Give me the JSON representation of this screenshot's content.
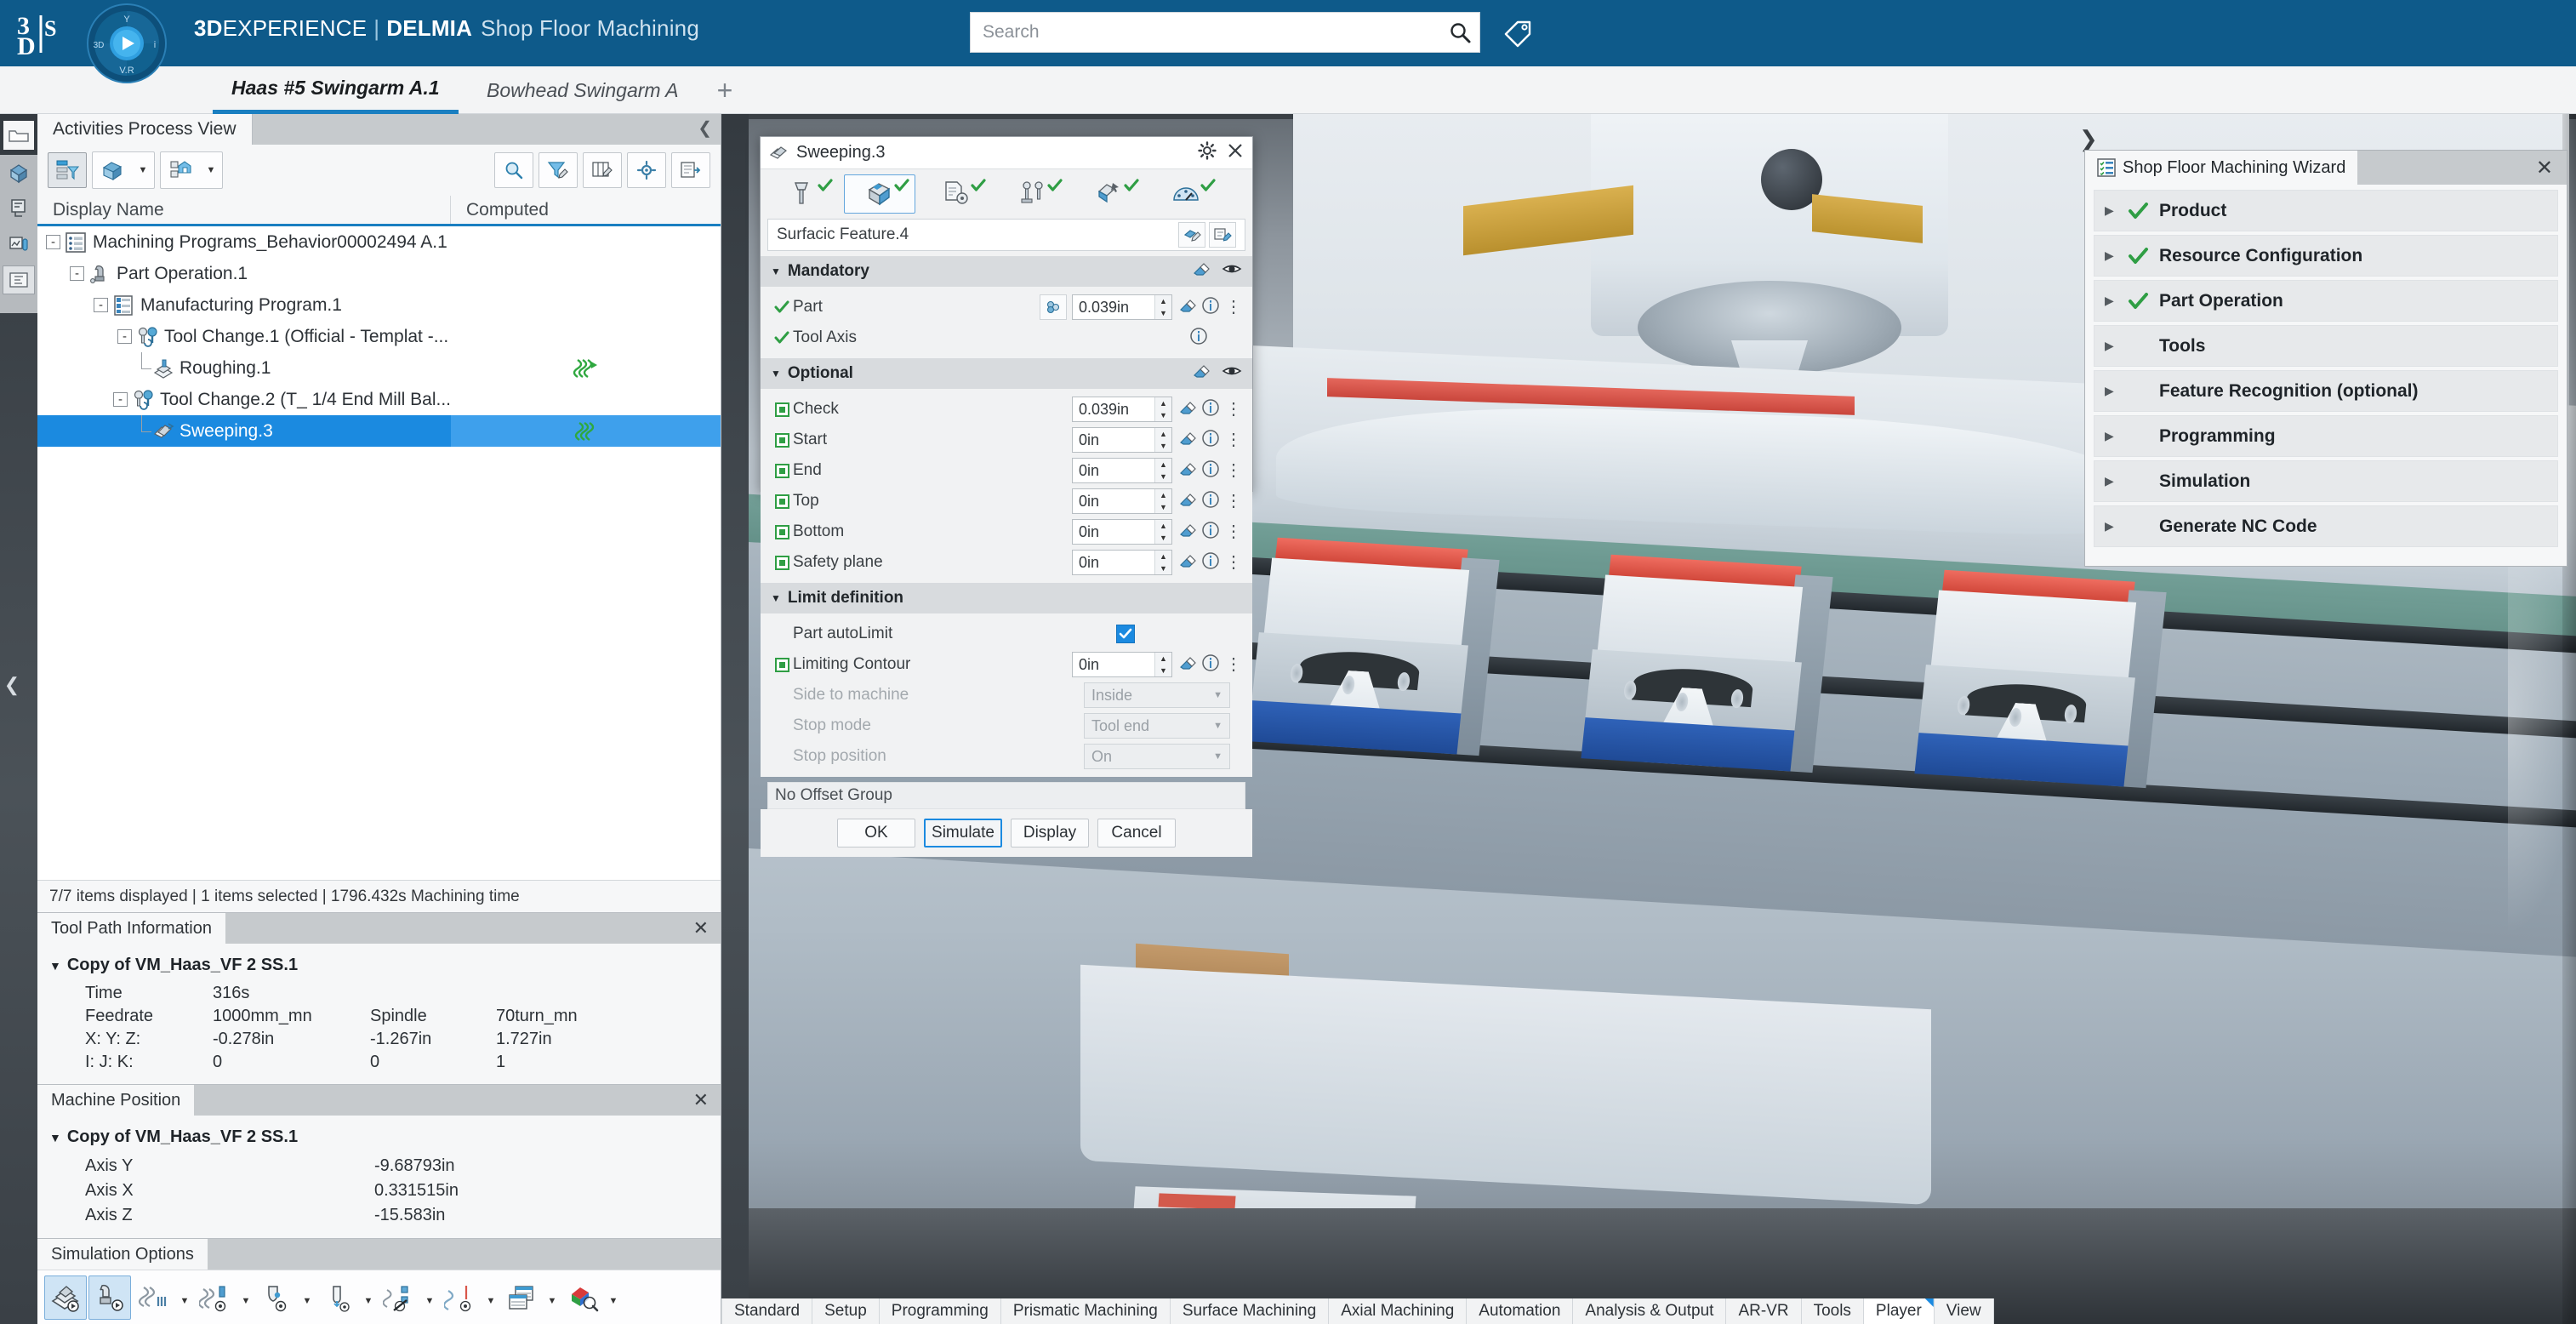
{
  "app": {
    "brand_bold": "3D",
    "brand_rest": "EXPERIENCE",
    "brand_sep": "|",
    "brand_suite": "DELMIA",
    "brand_app": "Shop Floor Machining",
    "logo_text": "3DS",
    "accent_blue": "#0e5a8a",
    "select_blue": "#1b8ae0",
    "check_green": "#2f9e44"
  },
  "search": {
    "placeholder": "Search",
    "value": "",
    "icon": "search-icon",
    "tag_icon": "tag-icon"
  },
  "tabs": {
    "items": [
      {
        "label": "Haas #5 Swingarm A.1",
        "active": true
      },
      {
        "label": "Bowhead Swingarm A",
        "active": false
      }
    ],
    "add_label": "+"
  },
  "left_rail": {
    "icons": [
      "folder-icon",
      "model-icon",
      "behavior-icon",
      "analysis-icon",
      "tree-icon"
    ]
  },
  "activities_panel": {
    "tab_label": "Activities Process View",
    "collapse_icon": "chevron-up-icon",
    "toolbar": [
      {
        "name": "filter-tree-button",
        "icon": "filter-tree-icon",
        "has_caret": false
      },
      {
        "name": "product-view-button",
        "icon": "product-cube-icon",
        "has_caret": true
      },
      {
        "name": "home-scope-button",
        "icon": "home-scope-icon",
        "has_caret": true
      },
      {
        "name": "search-button",
        "icon": "magnifier-icon",
        "has_caret": false
      },
      {
        "name": "edit-filter-button",
        "icon": "funnel-edit-icon",
        "has_caret": false
      },
      {
        "name": "edit-columns-button",
        "icon": "columns-edit-icon",
        "has_caret": false
      },
      {
        "name": "settings-button",
        "icon": "gear-icon",
        "has_caret": false
      },
      {
        "name": "export-button",
        "icon": "export-icon",
        "has_caret": false
      }
    ],
    "columns": [
      "Display Name",
      "Computed"
    ],
    "rows": [
      {
        "label": "Machining Programs_Behavior00002494 A.1",
        "depth": 0,
        "expander": "-",
        "icon": "program-list-icon",
        "computed": "",
        "selected": false
      },
      {
        "label": "Part Operation.1",
        "depth": 1,
        "expander": "-",
        "icon": "part-operation-icon",
        "computed": "",
        "selected": false
      },
      {
        "label": "Manufacturing Program.1",
        "depth": 2,
        "expander": "-",
        "icon": "mfg-program-icon",
        "computed": "",
        "selected": false
      },
      {
        "label": "Tool Change.1 (Official - Templat -...",
        "depth": 3,
        "expander": "-",
        "icon": "tool-change-icon",
        "computed": "",
        "selected": false
      },
      {
        "label": "Roughing.1",
        "depth": 4,
        "expander": "",
        "icon": "roughing-icon",
        "computed": "toolpath-icon",
        "selected": false
      },
      {
        "label": "Tool Change.2 (T_ 1/4 End Mill Bal...",
        "depth": 3,
        "expander": "-",
        "icon": "tool-change-icon",
        "computed": "",
        "selected": false
      },
      {
        "label": "Sweeping.3",
        "depth": 4,
        "expander": "",
        "icon": "sweeping-icon",
        "computed": "toolpath-icon",
        "selected": true
      }
    ],
    "status": "7/7 items displayed | 1 items selected | 1796.432s Machining time"
  },
  "tool_path_information": {
    "tab_label": "Tool Path Information",
    "close_icon": "close-icon",
    "group_title": "Copy of VM_Haas_VF 2 SS.1",
    "rows": [
      {
        "k": "Time",
        "v1": "316s",
        "k2": "",
        "v2": "",
        "k3": "",
        "v3": ""
      },
      {
        "k": "Feedrate",
        "v1": "1000mm_mn",
        "k2": "Spindle",
        "v2": "",
        "k3": "70turn_mn",
        "v3": ""
      },
      {
        "k": "X: Y: Z:",
        "v1": "-0.278in",
        "k2": "-1.267in",
        "v2": "",
        "k3": "1.727in",
        "v3": ""
      },
      {
        "k": "I: J: K:",
        "v1": "0",
        "k2": "0",
        "v2": "",
        "k3": "1",
        "v3": ""
      }
    ]
  },
  "machine_position": {
    "tab_label": "Machine Position",
    "close_icon": "close-icon",
    "group_title": "Copy of VM_Haas_VF 2 SS.1",
    "rows": [
      {
        "k": "Axis Y",
        "v": "-9.68793in"
      },
      {
        "k": "Axis X",
        "v": "0.331515in"
      },
      {
        "k": "Axis Z",
        "v": "-15.583in"
      }
    ]
  },
  "simulation_options": {
    "tab_label": "Simulation Options",
    "buttons": [
      {
        "name": "simulate-material-removal-button",
        "icon": "material-removal-icon",
        "active": true,
        "caret": false
      },
      {
        "name": "simulate-machine-button",
        "icon": "machine-simulate-icon",
        "active": true,
        "caret": false
      },
      {
        "name": "toolpath-display-button",
        "icon": "toolpath-icon",
        "active": false,
        "caret": true
      },
      {
        "name": "toolpath-tool-button",
        "icon": "toolpath-tool-icon",
        "active": false,
        "caret": true
      },
      {
        "name": "tool-visibility-button",
        "icon": "tool-eye-icon",
        "active": false,
        "caret": true
      },
      {
        "name": "tool-axis-button",
        "icon": "tool-axis-eye-icon",
        "active": false,
        "caret": true
      },
      {
        "name": "feature-display-button",
        "icon": "feature-hidden-icon",
        "active": false,
        "caret": true
      },
      {
        "name": "cutter-axis-button",
        "icon": "cutter-axis-icon",
        "active": false,
        "caret": true
      },
      {
        "name": "nc-output-button",
        "icon": "nc-output-icon",
        "active": false,
        "caret": true
      },
      {
        "name": "analysis-color-button",
        "icon": "color-analysis-icon",
        "active": false,
        "caret": true
      }
    ]
  },
  "sweeping_dialog": {
    "title": "Sweeping.3",
    "title_icon": "sweeping-icon",
    "gear_icon": "gear-icon",
    "close_icon": "close-icon",
    "tabs": [
      {
        "name": "tab-tool",
        "icon": "tool-icon",
        "checked": true,
        "active": false
      },
      {
        "name": "tab-geometry",
        "icon": "geometry-icon",
        "checked": true,
        "active": true
      },
      {
        "name": "tab-strategy",
        "icon": "strategy-icon",
        "checked": true,
        "active": false
      },
      {
        "name": "tab-macros",
        "icon": "macros-icon",
        "checked": true,
        "active": false
      },
      {
        "name": "tab-feeds",
        "icon": "feeds-icon",
        "checked": true,
        "active": false
      },
      {
        "name": "tab-speeds",
        "icon": "speeds-gauge-icon",
        "checked": true,
        "active": false
      }
    ],
    "feature_name": "Surfacic Feature.4",
    "feature_buttons": [
      "select-feature-icon",
      "edit-feature-icon"
    ],
    "sections": [
      {
        "title": "Mandatory",
        "header_icons": [
          "eraser-icon",
          "eye-icon"
        ],
        "rows": [
          {
            "mark": "check",
            "label": "Part",
            "has_picker": true,
            "picker_icon": "part-pick-icon",
            "value": "0.039in",
            "has_spin": true,
            "icons": [
              "eraser-icon",
              "info-icon"
            ],
            "dots": true
          },
          {
            "mark": "check",
            "label": "Tool Axis",
            "has_picker": false,
            "value": null,
            "has_spin": false,
            "icons": [
              "info-icon"
            ],
            "dots": false
          }
        ]
      },
      {
        "title": "Optional",
        "header_icons": [
          "eraser-icon",
          "eye-icon"
        ],
        "rows": [
          {
            "mark": "greenbox",
            "label": "Check",
            "value": "0.039in",
            "has_spin": true,
            "icons": [
              "eraser-icon",
              "info-icon"
            ],
            "dots": true
          },
          {
            "mark": "greenbox",
            "label": "Start",
            "value": "0in",
            "has_spin": true,
            "icons": [
              "eraser-icon",
              "info-icon"
            ],
            "dots": true
          },
          {
            "mark": "greenbox",
            "label": "End",
            "value": "0in",
            "has_spin": true,
            "icons": [
              "eraser-icon",
              "info-icon"
            ],
            "dots": true
          },
          {
            "mark": "greenbox",
            "label": "Top",
            "value": "0in",
            "has_spin": true,
            "icons": [
              "eraser-icon",
              "info-icon"
            ],
            "dots": true
          },
          {
            "mark": "greenbox",
            "label": "Bottom",
            "value": "0in",
            "has_spin": true,
            "icons": [
              "eraser-icon",
              "info-icon"
            ],
            "dots": true
          },
          {
            "mark": "greenbox",
            "label": "Safety plane",
            "value": "0in",
            "has_spin": true,
            "icons": [
              "eraser-icon",
              "info-icon"
            ],
            "dots": true
          }
        ]
      }
    ],
    "limit_definition": {
      "title": "Limit definition",
      "part_autolimit_label": "Part autoLimit",
      "part_autolimit_checked": true,
      "limiting_contour_label": "Limiting Contour",
      "limiting_contour_value": "0in",
      "side_to_machine_label": "Side to machine",
      "side_to_machine_value": "Inside",
      "stop_mode_label": "Stop mode",
      "stop_mode_value": "Tool end",
      "stop_position_label": "Stop position",
      "stop_position_value": "On"
    },
    "offset_group": "No Offset Group",
    "buttons": [
      {
        "label": "OK",
        "primary": false
      },
      {
        "label": "Simulate",
        "primary": true
      },
      {
        "label": "Display",
        "primary": false
      },
      {
        "label": "Cancel",
        "primary": false
      }
    ]
  },
  "wizard": {
    "expander_icon": "chevron-right-icon",
    "title": "Shop Floor Machining Wizard",
    "title_icon": "wizard-list-icon",
    "close_icon": "close-icon",
    "items": [
      {
        "label": "Product",
        "checked": true
      },
      {
        "label": "Resource Configuration",
        "checked": true
      },
      {
        "label": "Part Operation",
        "checked": true
      },
      {
        "label": "Tools",
        "checked": false
      },
      {
        "label": "Feature Recognition (optional)",
        "checked": false
      },
      {
        "label": "Programming",
        "checked": false
      },
      {
        "label": "Simulation",
        "checked": false
      },
      {
        "label": "Generate NC Code",
        "checked": false
      }
    ]
  },
  "action_bar": {
    "items": [
      {
        "label": "Standard",
        "active": false
      },
      {
        "label": "Setup",
        "active": false
      },
      {
        "label": "Programming",
        "active": false
      },
      {
        "label": "Prismatic Machining",
        "active": false
      },
      {
        "label": "Surface Machining",
        "active": false
      },
      {
        "label": "Axial Machining",
        "active": false
      },
      {
        "label": "Automation",
        "active": false
      },
      {
        "label": "Analysis & Output",
        "active": false
      },
      {
        "label": "AR-VR",
        "active": false
      },
      {
        "label": "Tools",
        "active": false
      },
      {
        "label": "Player",
        "active": true
      },
      {
        "label": "View",
        "active": false
      }
    ]
  }
}
